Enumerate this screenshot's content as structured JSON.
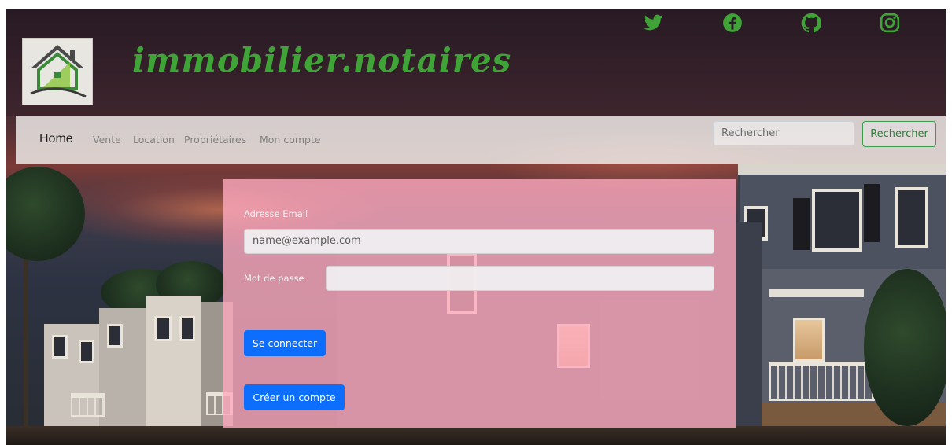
{
  "header": {
    "brand": "immobilier.notaires",
    "social_icons": [
      {
        "name": "twitter-icon",
        "color": "#3fa337"
      },
      {
        "name": "facebook-icon",
        "color": "#3fa337"
      },
      {
        "name": "github-icon",
        "color": "#3fa337"
      },
      {
        "name": "instagram-icon",
        "color": "#3fa337"
      }
    ]
  },
  "nav": {
    "home": "Home",
    "links": [
      "Vente",
      "Location",
      "Propriétaires",
      "Mon compte"
    ],
    "search_placeholder": "Rechercher",
    "search_button": "Rechercher"
  },
  "login": {
    "email_label": "Adresse Email",
    "email_placeholder": "name@example.com",
    "password_label": "Mot de passe",
    "password_value": "",
    "connect_button": "Se connecter",
    "create_button": "Créer un compte"
  },
  "colors": {
    "brand_green": "#3fa337",
    "primary_blue": "#0d6efd",
    "card_pink": "#ffaabe"
  }
}
